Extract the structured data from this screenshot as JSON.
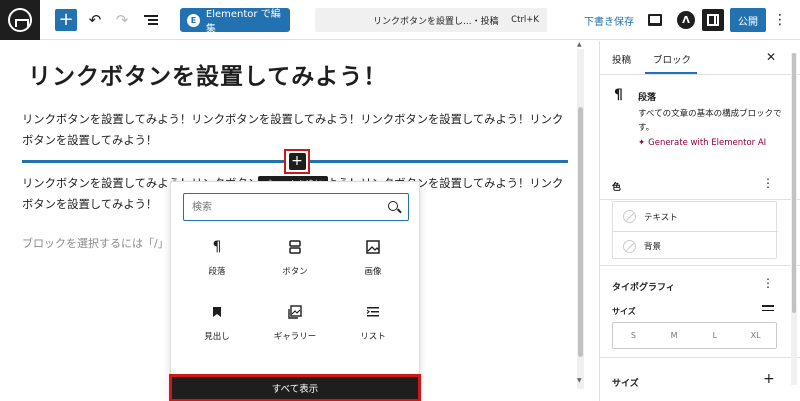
{
  "topbar": {
    "elementor_label": "Elementor で編集",
    "doc_title": "リンクボタンを設置し...・投稿",
    "shortcut": "Ctrl+K",
    "draft_save": "下書き保存",
    "publish": "公開"
  },
  "editor": {
    "title": "リンクボタンを設置してみよう！",
    "paragraph1": "リンクボタンを設置してみよう！リンクボタンを設置してみよう！リンクボタンを設置してみよう！リンクボタンを設置してみよう！",
    "paragraph2": "リンクボタンを設置してみよう！リンクボタンを設置してみよう！リンクボタンを設置してみよう！リンクボタンを設置してみよう！",
    "placeholder": "ブロックを選択するには「/」",
    "tooltip": "ブロックを追加"
  },
  "inserter": {
    "search_placeholder": "検索",
    "blocks": [
      {
        "label": "段落",
        "icon": "paragraph-icon"
      },
      {
        "label": "ボタン",
        "icon": "button-icon"
      },
      {
        "label": "画像",
        "icon": "image-icon"
      },
      {
        "label": "見出し",
        "icon": "heading-icon"
      },
      {
        "label": "ギャラリー",
        "icon": "gallery-icon"
      },
      {
        "label": "リスト",
        "icon": "list-icon"
      }
    ],
    "show_all": "すべて表示"
  },
  "sidebar": {
    "tabs": [
      "投稿",
      "ブロック"
    ],
    "active_tab": "ブロック",
    "block_name": "段落",
    "block_desc": "すべての文章の基本の構成ブロックです。",
    "generate_ai": "Generate with Elementor AI",
    "color_title": "色",
    "color_text": "テキスト",
    "color_bg": "背景",
    "typography_title": "タイポグラフィ",
    "size_label": "サイズ",
    "sizes": [
      "S",
      "M",
      "L",
      "XL"
    ],
    "size_section": "サイズ"
  },
  "colors": {
    "accent": "#2271b1",
    "highlight": "#cc1818",
    "dark": "#1e1e1e",
    "ai": "#93003f"
  }
}
